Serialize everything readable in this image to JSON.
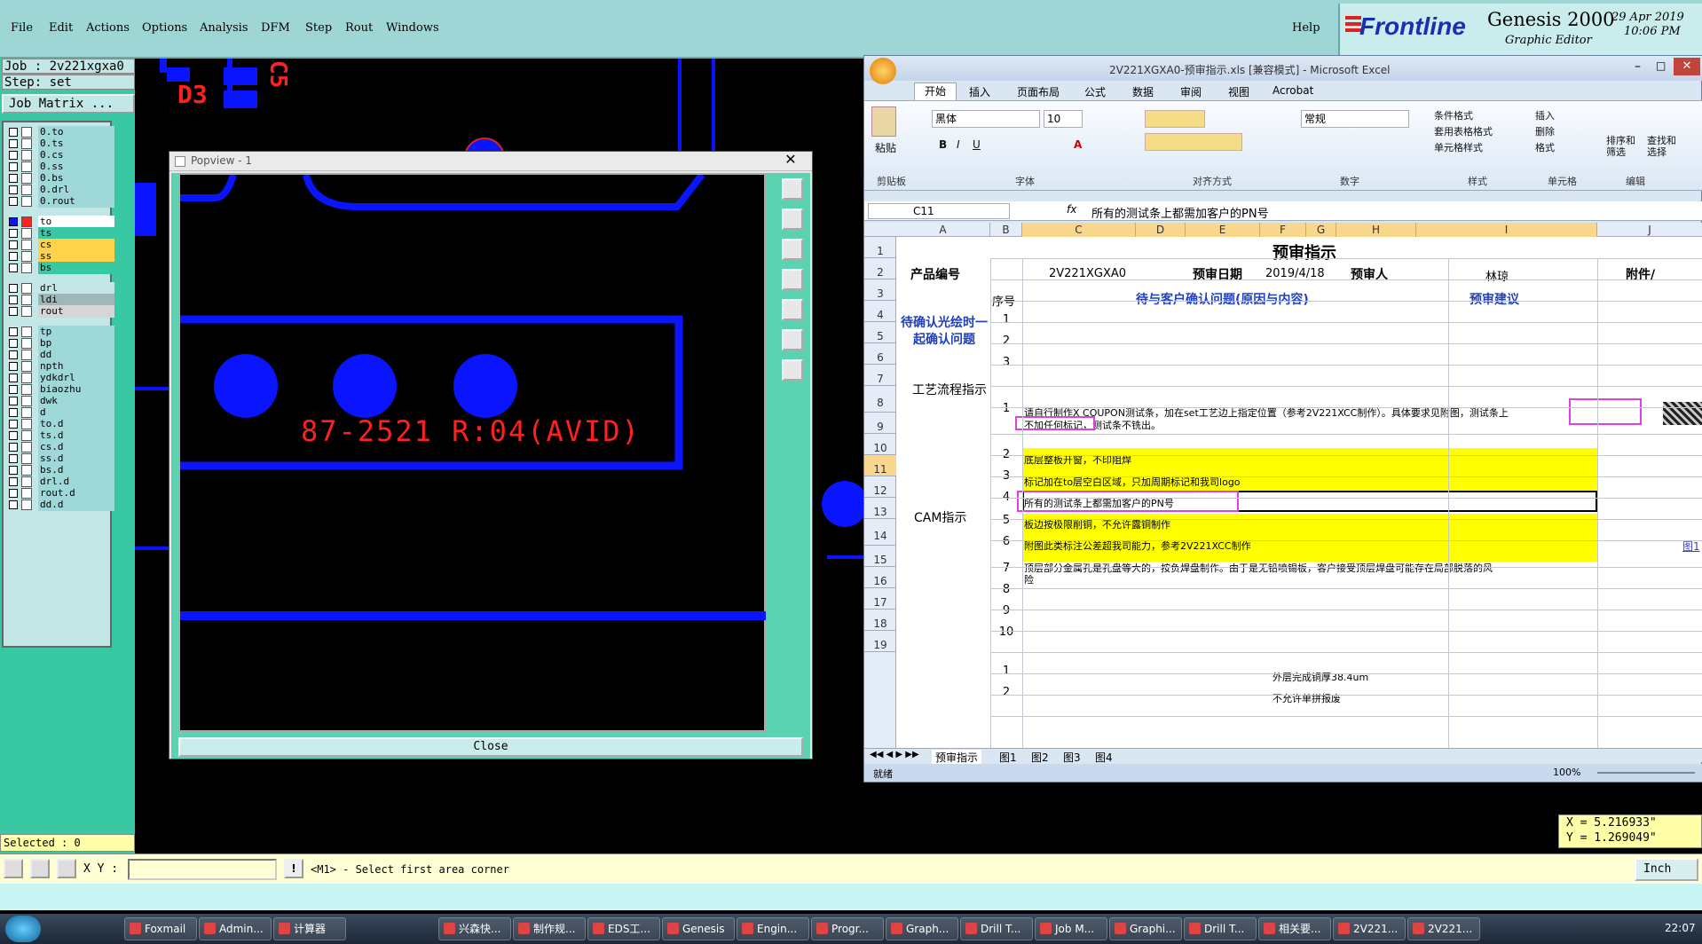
{
  "menu": [
    "File",
    "Edit",
    "Actions",
    "Options",
    "Analysis",
    "DFM",
    "Step",
    "Rout",
    "Windows"
  ],
  "help_label": "Help",
  "brand": {
    "logo": "Frontline",
    "product": "Genesis 2000",
    "subtitle": "Graphic Editor",
    "date": "29 Apr 2019",
    "time": "10:06 PM"
  },
  "job": {
    "job_label": "Job : 2v221xgxa0",
    "step_label": "Step: set",
    "matrix_button": "Job Matrix ..."
  },
  "layers_group1": [
    "0.to",
    "0.ts",
    "0.cs",
    "0.ss",
    "0.bs",
    "0.drl",
    "0.rout"
  ],
  "layers_group2": [
    "to",
    "ts",
    "cs",
    "ss",
    "bs"
  ],
  "layers_group3": [
    "drl",
    "ldi",
    "rout"
  ],
  "layers_group4": [
    "tp",
    "bp",
    "dd",
    "npth",
    "ydkdrl",
    "biaozhu",
    "dwk",
    "d",
    "to.d",
    "ts.d",
    "cs.d",
    "ss.d",
    "bs.d",
    "drl.d",
    "rout.d",
    "dd.d"
  ],
  "selected_label": "Selected : 0",
  "canvas": {
    "d3": "D3",
    "c5": "C5"
  },
  "popview": {
    "title": "Popview - 1",
    "board_text": "87-2521 R:04(AVID)",
    "close": "Close"
  },
  "excel": {
    "title": "2V221XGXA0-预审指示.xls [兼容模式] - Microsoft Excel",
    "tabs": [
      "开始",
      "插入",
      "页面布局",
      "公式",
      "数据",
      "审阅",
      "视图",
      "Acrobat"
    ],
    "font_name": "黑体",
    "font_size": "10",
    "number_format": "常规",
    "groups": [
      "剪贴板",
      "字体",
      "对齐方式",
      "数字",
      "样式",
      "单元格",
      "编辑"
    ],
    "paste": "粘贴",
    "style_items": [
      "条件格式",
      "套用表格格式",
      "单元格样式"
    ],
    "cell_items": [
      "插入",
      "删除",
      "格式"
    ],
    "edit_items": [
      "排序和筛选",
      "查找和选择"
    ],
    "name_box": "C11",
    "formula": "所有的测试条上都需加客户的PN号",
    "columns": [
      "A",
      "B",
      "C",
      "D",
      "E",
      "F",
      "G",
      "H",
      "I",
      "J"
    ],
    "rows": [
      "1",
      "2",
      "3",
      "4",
      "5",
      "6",
      "7",
      "8",
      "9",
      "10",
      "11",
      "12",
      "13",
      "14",
      "15",
      "16",
      "17",
      "18",
      "19"
    ],
    "sheet_title": "预审指示",
    "product_label": "产品编号",
    "product_value": "2V221XGXA0",
    "date_label": "预审日期",
    "date_value": "2019/4/18",
    "reviewer_label": "预审人",
    "reviewer_value": "林琼",
    "attach_label": "附件/",
    "seq_label": "序号",
    "issue_header": "待与客户确认问题(原因与内容)",
    "advice_header": "预审建议",
    "confirm_label": "待确认光绘时一起确认问题",
    "process_label": "工艺流程指示",
    "cam_label": "CAM指示",
    "seq": [
      "1",
      "2",
      "3",
      "1",
      "2",
      "3",
      "4",
      "5",
      "6",
      "7",
      "8",
      "9",
      "10",
      "1",
      "2"
    ],
    "instr_1": "请自行制作X COUPON测试条，加在set工艺边上指定位置（参考2V221XCC制作）。具体要求见附图，测试条上",
    "instr_1b": "不加任何标记，测试条不铣出。",
    "instr_2": "底层整板开窗，不印阻焊",
    "instr_3": "标记加在to层空白区域，只加周期标记和我司logo",
    "instr_4": "所有的测试条上都需加客户的PN号",
    "instr_5": "板边按极限削铜，不允许露铜制作",
    "instr_6": "附图此类标注公差超我司能力，参考2V221XCC制作",
    "instr_6_link": "图1",
    "instr_7": "顶层部分金属孔是孔盘等大的，按负焊盘制作。由于是无铅喷锡板，客户接受顶层焊盘可能存在局部脱落的风",
    "instr_7b": "险",
    "instr_18": "外层完成铜厚38.4um",
    "instr_19": "不允许单拼报废",
    "sheets": [
      "预审指示",
      "图1",
      "图2",
      "图3",
      "图4"
    ],
    "status": "就绪",
    "zoom": "100%"
  },
  "coords": {
    "x": "X = 5.216933\"",
    "y": "Y = 1.269049\""
  },
  "xy_label": "X Y :",
  "prompt": "<M1> - Select first area corner",
  "units": "Inch",
  "taskbar": [
    "Foxmail",
    "Admin...",
    "计算器",
    "",
    "",
    "",
    "兴森快...",
    "制作规...",
    "EDS工...",
    "Genesis",
    "Engin...",
    "Progr...",
    "Graph...",
    "Drill T...",
    "Job M...",
    "Graphi...",
    "Drill T...",
    "相关要...",
    "2V221...",
    "2V221..."
  ],
  "clock": "22:07",
  "colors": {
    "cyan": "#9ed6d6",
    "green": "#38c9a4",
    "board_blue": "#0a14ff",
    "text_red": "#ff2020",
    "highlight": "#e040e0",
    "excel_yellow": "#ffff00"
  }
}
